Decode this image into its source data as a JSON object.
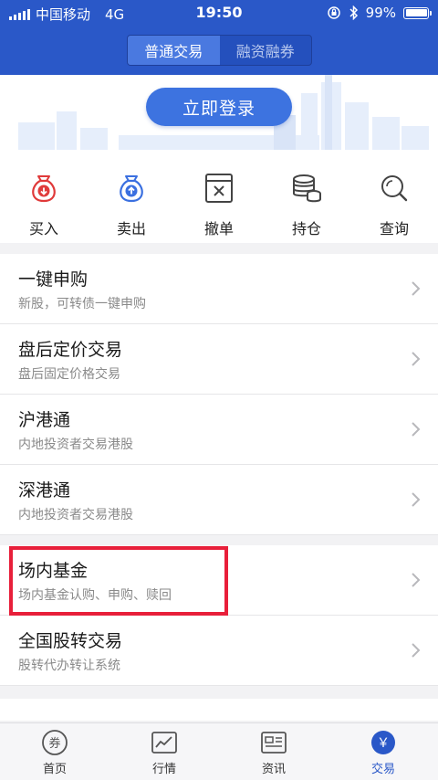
{
  "status_bar": {
    "carrier": "中国移动",
    "network": "4G",
    "time": "19:50",
    "battery": "99%"
  },
  "segment": {
    "options": [
      "普通交易",
      "融资融券"
    ],
    "active_index": 0
  },
  "login": {
    "label": "立即登录"
  },
  "quick_actions": [
    {
      "label": "买入",
      "icon": "buy-moneybag-icon",
      "color": "#e03a3a"
    },
    {
      "label": "卖出",
      "icon": "sell-moneybag-icon",
      "color": "#3b70e0"
    },
    {
      "label": "撤单",
      "icon": "cancel-order-icon"
    },
    {
      "label": "持仓",
      "icon": "coin-stack-icon"
    },
    {
      "label": "查询",
      "icon": "search-icon"
    }
  ],
  "list": [
    {
      "title": "一键申购",
      "subtitle": "新股，可转债一键申购"
    },
    {
      "title": "盘后定价交易",
      "subtitle": "盘后固定价格交易"
    },
    {
      "title": "沪港通",
      "subtitle": "内地投资者交易港股"
    },
    {
      "title": "深港通",
      "subtitle": "内地投资者交易港股"
    },
    {
      "title": "场内基金",
      "subtitle": "场内基金认购、申购、赎回"
    },
    {
      "title": "全国股转交易",
      "subtitle": "股转代办转让系统"
    }
  ],
  "tabs": [
    {
      "label": "首页",
      "icon": "coupon-icon",
      "glyph": "券"
    },
    {
      "label": "行情",
      "icon": "market-chart-icon"
    },
    {
      "label": "资讯",
      "icon": "news-icon"
    },
    {
      "label": "交易",
      "icon": "trade-yen-icon",
      "glyph": "￥",
      "active": true
    }
  ],
  "colors": {
    "brand": "#2a58c8",
    "highlight": "#e81f3a"
  }
}
